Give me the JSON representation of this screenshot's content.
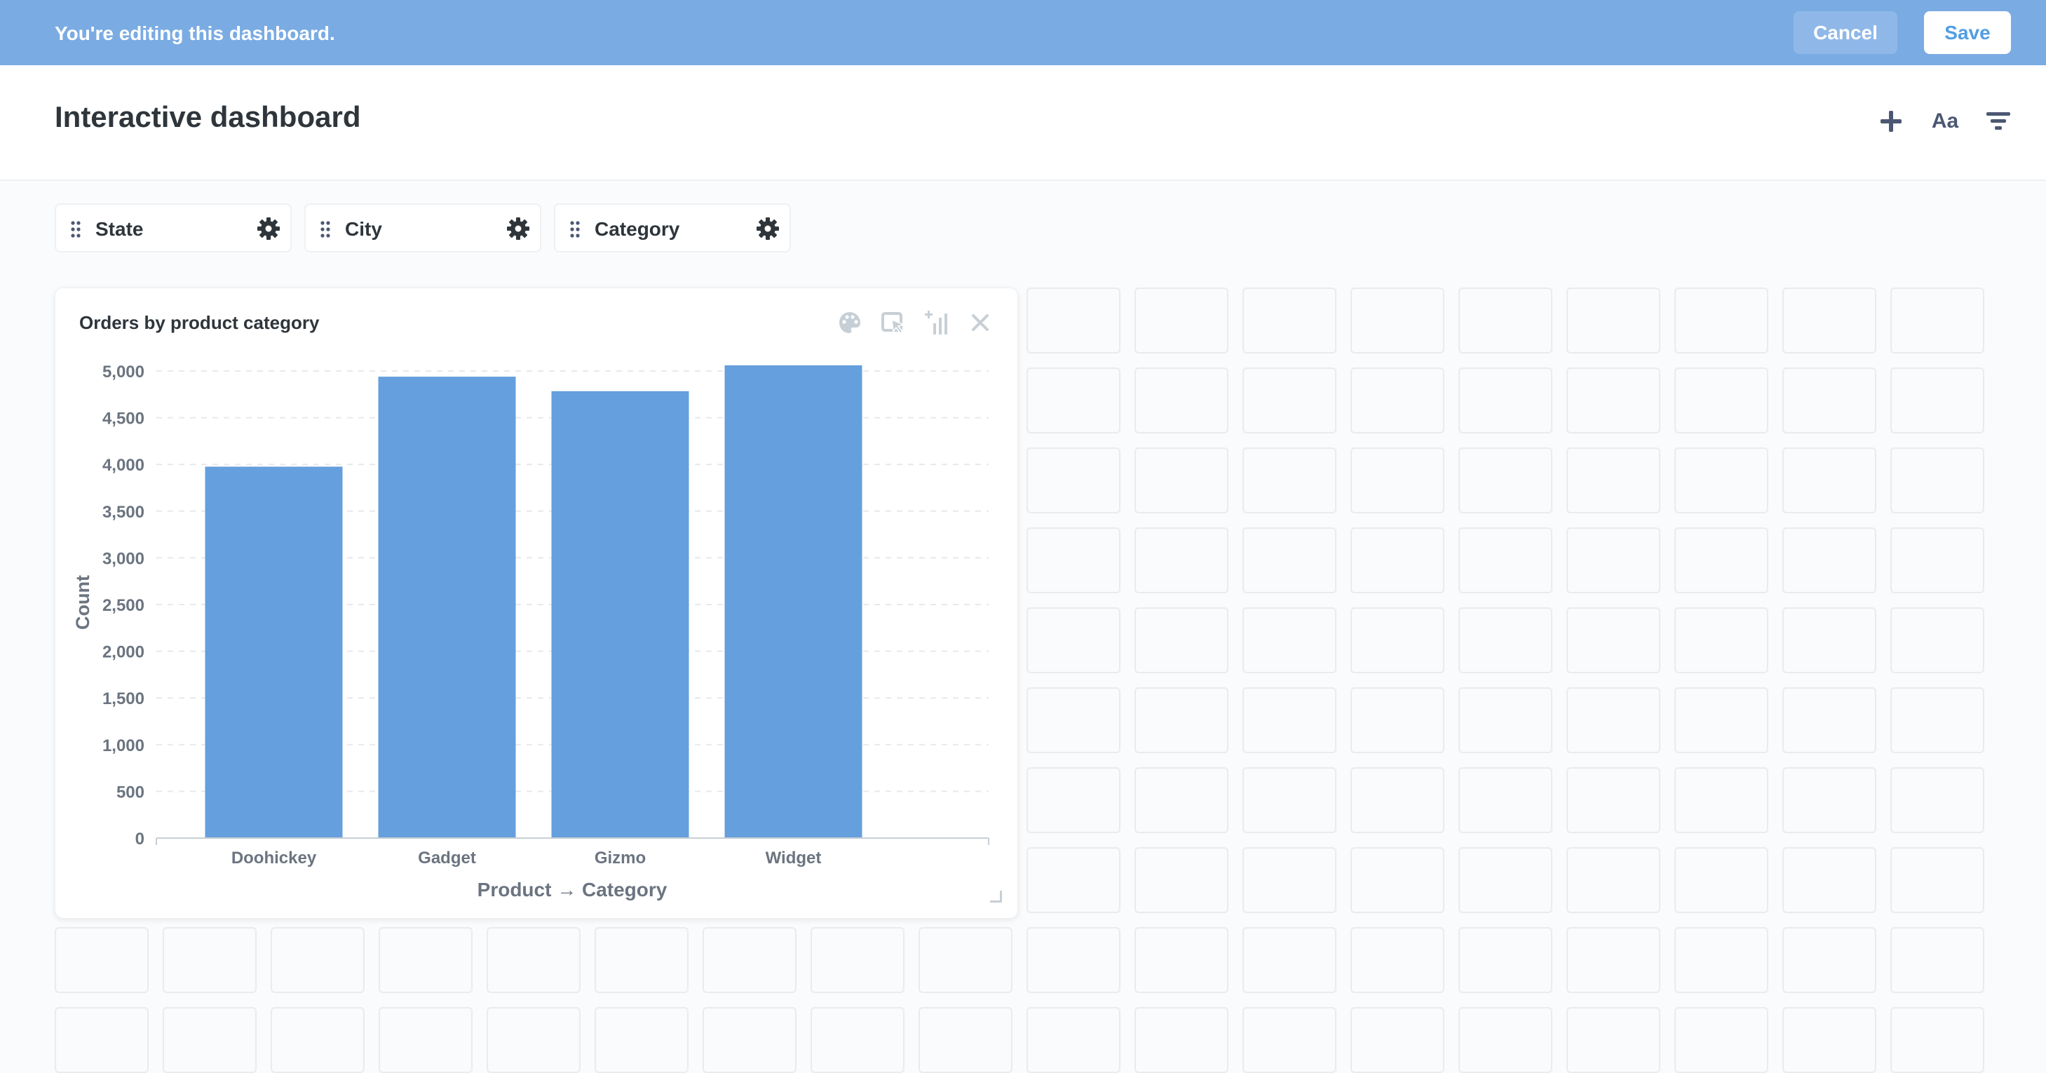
{
  "edit_bar": {
    "message": "You're editing this dashboard.",
    "cancel_label": "Cancel",
    "save_label": "Save"
  },
  "header": {
    "title": "Interactive dashboard",
    "icons": [
      "plus-icon",
      "text-icon",
      "filter-icon"
    ],
    "text_icon_label": "Aa"
  },
  "filters": [
    {
      "label": "State"
    },
    {
      "label": "City"
    },
    {
      "label": "Category"
    }
  ],
  "card": {
    "title": "Orders by product category",
    "actions": [
      "palette-icon",
      "click-behavior-icon",
      "add-series-icon",
      "close-icon"
    ]
  },
  "chart_data": {
    "type": "bar",
    "categories": [
      "Doohickey",
      "Gadget",
      "Gizmo",
      "Widget"
    ],
    "values": [
      3976,
      4939,
      4784,
      5061
    ],
    "xlabel": "Product → Category",
    "ylabel": "Count",
    "ylim": [
      0,
      5000
    ],
    "yticks": [
      "0",
      "500",
      "1,000",
      "1,500",
      "2,000",
      "2,500",
      "3,000",
      "3,500",
      "4,000",
      "4,500",
      "5,000"
    ],
    "grid": true,
    "bar_color": "#659fdd"
  },
  "colors": {
    "edit_bar": "#7aabe3",
    "accent": "#509ee3",
    "bar": "#659fdd"
  }
}
